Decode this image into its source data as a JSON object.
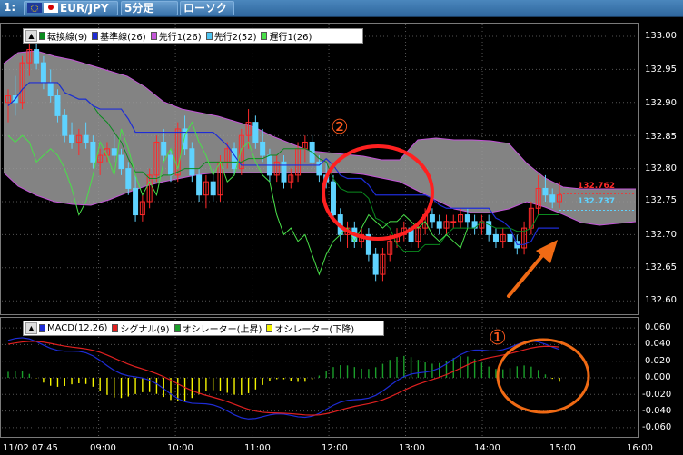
{
  "toolbar": {
    "window_number": "1:",
    "pair": "EUR/JPY",
    "timeframe": "5分足",
    "chart_type": "ローソク"
  },
  "main_legend": [
    {
      "label": "転換線(9)",
      "color": "#0a8a1e"
    },
    {
      "label": "基準線(26)",
      "color": "#1e2cd6"
    },
    {
      "label": "先行1(26)",
      "color": "#c456d8"
    },
    {
      "label": "先行2(52)",
      "color": "#4ec4f0"
    },
    {
      "label": "遅行1(26)",
      "color": "#49e049"
    }
  ],
  "macd_legend": [
    {
      "label": "MACD(12,26)",
      "color": "#1e2cd6"
    },
    {
      "label": "シグナル(9)",
      "color": "#e02020"
    },
    {
      "label": "オシレーター(上昇)",
      "color": "#1a9e2a"
    },
    {
      "label": "オシレーター(下降)",
      "color": "#f5f500"
    }
  ],
  "price_axis": [
    "133.00",
    "132.95",
    "132.90",
    "132.85",
    "132.80",
    "132.75",
    "132.70",
    "132.65",
    "132.60"
  ],
  "macd_axis": [
    "0.060",
    "0.040",
    "0.020",
    "0.000",
    "-0.020",
    "-0.040",
    "-0.060"
  ],
  "time_axis": [
    "11/02 07:45",
    "09:00",
    "10:00",
    "11:00",
    "12:00",
    "13:00",
    "14:00",
    "15:00",
    "16:00"
  ],
  "price_tags": {
    "red": "132.762",
    "blue": "132.737"
  },
  "annotations": {
    "circle1": "①",
    "circle2": "②"
  },
  "colors": {
    "bull_candle": "#ff2a2a",
    "bear_candle": "#5fd3ff",
    "cloud": "#9a9a9a",
    "annotation": "#ff2020",
    "arrow": "#f06a14"
  },
  "chart_data": [
    {
      "type": "candlestick",
      "ylim": [
        132.58,
        133.02
      ],
      "x_range": [
        "07:45",
        "16:00"
      ],
      "candles": [
        [
          132.9,
          132.92,
          132.87,
          132.91
        ],
        [
          132.91,
          132.94,
          132.88,
          132.9
        ],
        [
          132.9,
          132.97,
          132.89,
          132.96
        ],
        [
          132.96,
          132.99,
          132.94,
          132.98
        ],
        [
          132.98,
          132.99,
          132.95,
          132.96
        ],
        [
          132.96,
          132.97,
          132.92,
          132.93
        ],
        [
          132.93,
          132.95,
          132.9,
          132.91
        ],
        [
          132.91,
          132.92,
          132.87,
          132.88
        ],
        [
          132.88,
          132.89,
          132.84,
          132.85
        ],
        [
          132.85,
          132.87,
          132.83,
          132.84
        ],
        [
          132.84,
          132.86,
          132.82,
          132.85
        ],
        [
          132.85,
          132.87,
          132.83,
          132.84
        ],
        [
          132.84,
          132.85,
          132.8,
          132.81
        ],
        [
          132.81,
          132.83,
          132.79,
          132.82
        ],
        [
          132.82,
          132.84,
          132.81,
          132.83
        ],
        [
          132.83,
          132.85,
          132.81,
          132.82
        ],
        [
          132.82,
          132.83,
          132.79,
          132.8
        ],
        [
          132.8,
          132.81,
          132.76,
          132.77
        ],
        [
          132.77,
          132.79,
          132.72,
          132.73
        ],
        [
          132.73,
          132.76,
          132.72,
          132.75
        ],
        [
          132.75,
          132.8,
          132.74,
          132.79
        ],
        [
          132.79,
          132.85,
          132.78,
          132.84
        ],
        [
          132.84,
          132.86,
          132.81,
          132.82
        ],
        [
          132.82,
          132.83,
          132.78,
          132.79
        ],
        [
          132.79,
          132.87,
          132.78,
          132.86
        ],
        [
          132.86,
          132.88,
          132.82,
          132.83
        ],
        [
          132.83,
          132.84,
          132.78,
          132.79
        ],
        [
          132.79,
          132.8,
          132.75,
          132.76
        ],
        [
          132.76,
          132.79,
          132.74,
          132.78
        ],
        [
          132.78,
          132.8,
          132.75,
          132.76
        ],
        [
          132.76,
          132.82,
          132.75,
          132.81
        ],
        [
          132.81,
          132.84,
          132.8,
          132.83
        ],
        [
          132.83,
          132.84,
          132.79,
          132.8
        ],
        [
          132.8,
          132.86,
          132.79,
          132.85
        ],
        [
          132.85,
          132.89,
          132.83,
          132.87
        ],
        [
          132.87,
          132.88,
          132.83,
          132.84
        ],
        [
          132.84,
          132.86,
          132.81,
          132.82
        ],
        [
          132.82,
          132.83,
          132.78,
          132.79
        ],
        [
          132.79,
          132.82,
          132.78,
          132.81
        ],
        [
          132.81,
          132.82,
          132.77,
          132.78
        ],
        [
          132.78,
          132.8,
          132.77,
          132.79
        ],
        [
          132.79,
          132.84,
          132.78,
          132.83
        ],
        [
          132.83,
          132.85,
          132.81,
          132.84
        ],
        [
          132.84,
          132.85,
          132.8,
          132.81
        ],
        [
          132.81,
          132.82,
          132.78,
          132.79
        ],
        [
          132.79,
          132.81,
          132.77,
          132.78
        ],
        [
          132.78,
          132.79,
          132.72,
          132.73
        ],
        [
          132.73,
          132.74,
          132.69,
          132.7
        ],
        [
          132.7,
          132.72,
          132.68,
          132.71
        ],
        [
          132.71,
          132.72,
          132.68,
          132.69
        ],
        [
          132.69,
          132.71,
          132.68,
          132.7
        ],
        [
          132.7,
          132.71,
          132.66,
          132.67
        ],
        [
          132.67,
          132.68,
          132.63,
          132.64
        ],
        [
          132.64,
          132.68,
          132.63,
          132.67
        ],
        [
          132.67,
          132.7,
          132.66,
          132.69
        ],
        [
          132.69,
          132.71,
          132.68,
          132.7
        ],
        [
          132.7,
          132.72,
          132.69,
          132.71
        ],
        [
          132.71,
          132.72,
          132.68,
          132.69
        ],
        [
          132.69,
          132.72,
          132.68,
          132.71
        ],
        [
          132.71,
          132.74,
          132.7,
          132.73
        ],
        [
          132.73,
          132.74,
          132.71,
          132.72
        ],
        [
          132.72,
          132.73,
          132.7,
          132.71
        ],
        [
          132.71,
          132.73,
          132.7,
          132.72
        ],
        [
          132.72,
          132.73,
          132.71,
          132.72
        ],
        [
          132.72,
          132.74,
          132.71,
          132.73
        ],
        [
          132.73,
          132.74,
          132.71,
          132.72
        ],
        [
          132.72,
          132.73,
          132.7,
          132.71
        ],
        [
          132.71,
          132.73,
          132.7,
          132.72
        ],
        [
          132.72,
          132.73,
          132.69,
          132.7
        ],
        [
          132.7,
          132.71,
          132.68,
          132.69
        ],
        [
          132.69,
          132.71,
          132.68,
          132.7
        ],
        [
          132.7,
          132.71,
          132.68,
          132.69
        ],
        [
          132.69,
          132.7,
          132.67,
          132.68
        ],
        [
          132.68,
          132.72,
          132.67,
          132.71
        ],
        [
          132.71,
          132.75,
          132.7,
          132.74
        ],
        [
          132.74,
          132.79,
          132.73,
          132.77
        ],
        [
          132.77,
          132.79,
          132.75,
          132.76
        ],
        [
          132.76,
          132.77,
          132.74,
          132.75
        ],
        [
          132.75,
          132.78,
          132.74,
          132.76
        ]
      ]
    },
    {
      "type": "line",
      "series": [
        "MACD",
        "シグナル",
        "オシレーター"
      ],
      "ylim": [
        -0.065,
        0.065
      ]
    }
  ]
}
